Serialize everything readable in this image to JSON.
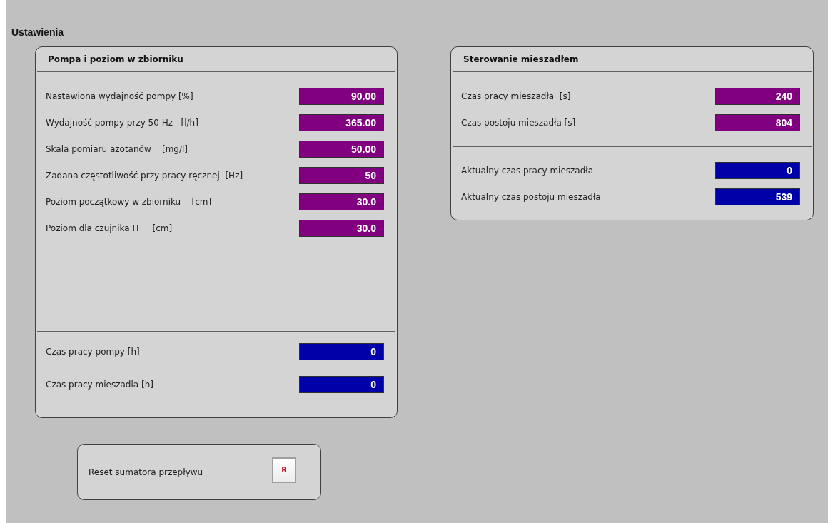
{
  "title": "Ustawienia",
  "panels": [
    {
      "title": "Pompa i poziom w zbiorniku",
      "sections": [
        {
          "rows": [
            {
              "label": "Nastawiona wydajność pompy [%]",
              "value": "90.00",
              "kind": "setpoint"
            },
            {
              "label": "Wydajność pompy przy 50 Hz   [l/h]",
              "value": "365.00",
              "kind": "setpoint"
            },
            {
              "label": "Skala pomiaru azotanów    [mg/l]",
              "value": "50.00",
              "kind": "setpoint"
            },
            {
              "label": "Zadana częstotliwość przy pracy ręcznej  [Hz]",
              "value": "50",
              "kind": "setpoint"
            },
            {
              "label": "Poziom początkowy w zbiorniku    [cm]",
              "value": "30.0",
              "kind": "setpoint"
            },
            {
              "label": "Poziom dla czujnika H     [cm]",
              "value": "30.0",
              "kind": "setpoint"
            }
          ]
        },
        {
          "rows": [
            {
              "label": "Czas pracy pompy [h]",
              "value": "0",
              "kind": "actual"
            },
            {
              "label": "Czas pracy mieszadla [h]",
              "value": "0",
              "kind": "actual"
            }
          ]
        }
      ]
    },
    {
      "title": "Sterowanie mieszadłem",
      "sections": [
        {
          "rows": [
            {
              "label": "Czas pracy mieszadła  [s]",
              "value": "240",
              "kind": "setpoint"
            },
            {
              "label": "Czas postoju mieszadła [s]",
              "value": "804",
              "kind": "setpoint"
            }
          ]
        },
        {
          "rows": [
            {
              "label": "Aktualny czas pracy mieszadła",
              "value": "0",
              "kind": "actual"
            },
            {
              "label": "Aktualny czas postoju mieszadła",
              "value": "539",
              "kind": "actual"
            }
          ]
        }
      ]
    }
  ],
  "reset": {
    "label": "Reset sumatora przepływu",
    "button": "R"
  }
}
